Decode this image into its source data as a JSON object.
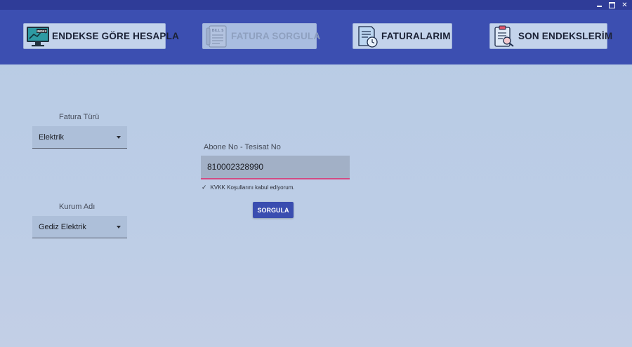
{
  "window": {
    "controls": [
      "minimize",
      "maximize",
      "close"
    ]
  },
  "colors": {
    "titlebar": "#2f3c98",
    "header": "#3c4fb1",
    "accent": "#d24a82",
    "primary_button": "#3a4db0"
  },
  "nav": {
    "endekse_gore_hesapla": {
      "label": "ENDEKSE GÖRE HESAPLA",
      "icon": "monitor-chart-icon",
      "index_text": "INDEX"
    },
    "fatura_sorgula": {
      "label": "FATURA SORGULA",
      "icon": "bill-icon",
      "bill_text": "BILL $",
      "disabled": true
    },
    "faturalarim": {
      "label": "FATURALARIM",
      "icon": "document-clock-icon"
    },
    "son_endekslerim": {
      "label": "SON ENDEKSLERİM",
      "icon": "clipboard-search-icon"
    }
  },
  "form": {
    "fatura_turu": {
      "label": "Fatura Türü",
      "value": "Elektrik"
    },
    "kurum_adi": {
      "label": "Kurum Adı",
      "value": "Gediz Elektrik"
    },
    "abone_no": {
      "label": "Abone No - Tesisat No",
      "value": "810002328990"
    },
    "kvkk": {
      "checked": true,
      "check_mark": "✓",
      "label": "KVKK Koşullarını kabul ediyorum."
    },
    "submit_label": "SORGULA"
  }
}
